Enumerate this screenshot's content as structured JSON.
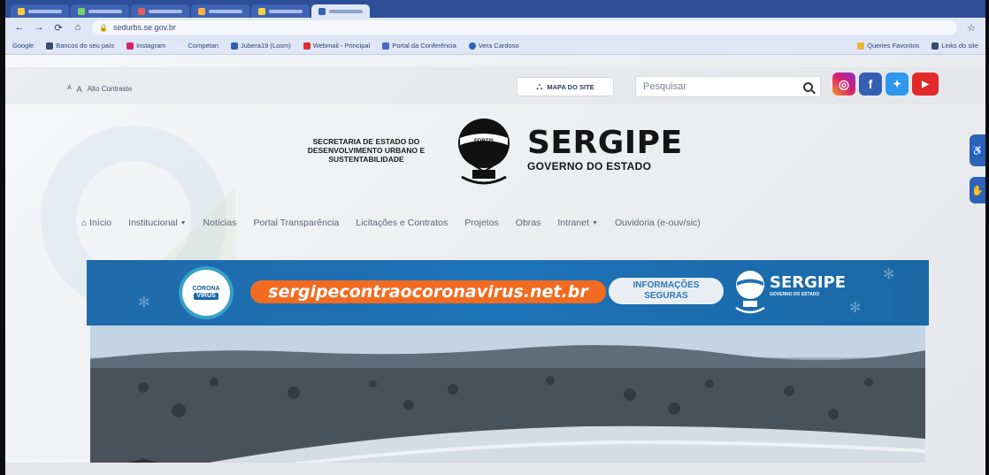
{
  "browser": {
    "url": "sedurbs.se.gov.br",
    "bookmarks": [
      "Google",
      "Bancos do seu país",
      "Instagram",
      "Competan",
      "Jubera19 (Losm)",
      "Webmail - Principal",
      "Portal da Conferência",
      "Vera Cardoso",
      "Queries Favoritos",
      "Links do site"
    ]
  },
  "site": {
    "accessibility": {
      "font_small": "A",
      "font_large": "A",
      "contrast": "Alto Contraste"
    },
    "sitemap_label": "MAPA DO SITE",
    "search": {
      "placeholder": "Pesquisar"
    },
    "social": {
      "instagram": "instagram-icon",
      "facebook": "facebook-icon",
      "twitter": "twitter-icon",
      "youtube": "youtube-icon"
    },
    "secretaria": "SECRETARIA DE ESTADO DO DESENVOLVIMENTO URBANO E SUSTENTABILIDADE",
    "brand": {
      "title": "SERGIPE",
      "subtitle": "GOVERNO DO ESTADO",
      "balloon_label": "FORTIS"
    },
    "menu": {
      "home": "Início",
      "institucional": "Institucional",
      "noticias": "Notícias",
      "transparencia": "Portal Transparência",
      "licitacoes": "Licitações e Contratos",
      "projetos": "Projetos",
      "obras": "Obras",
      "intranet": "Intranet",
      "ouvidoria": "Ouvidoria (e-ouv/sic)"
    },
    "banner": {
      "badge_line1": "CORONA",
      "badge_line2": "VIRUS",
      "url": "sergipecontraocoronavirus.net.br",
      "info_line1": "INFORMAÇÕES",
      "info_line2": "SEGURAS",
      "brand": "SERGIPE",
      "brand_sub": "GOVERNO DO ESTADO"
    }
  },
  "colors": {
    "accent": "#1d72b6",
    "orange": "#f26b20",
    "chrome": "#2d4f9a"
  }
}
